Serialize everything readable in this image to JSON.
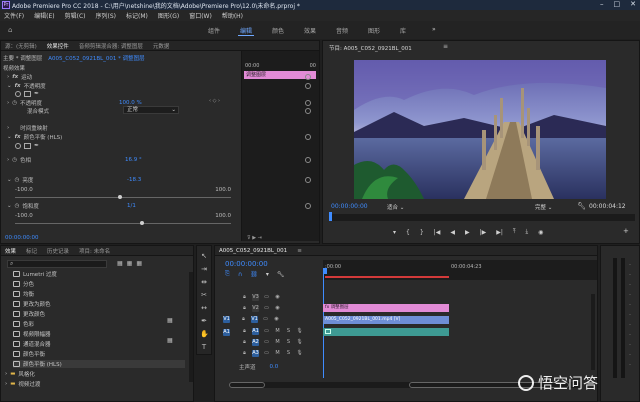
{
  "app": {
    "title": "Adobe Premiere Pro CC 2018 - C:\\用户\\netshine\\我的文档\\Adobe\\Premiere Pro\\12.0\\未命名.prproj *",
    "icon": "Pr"
  },
  "menu": [
    "文件(F)",
    "编辑(E)",
    "剪辑(C)",
    "序列(S)",
    "标记(M)",
    "图形(G)",
    "窗口(W)",
    "帮助(H)"
  ],
  "workspaces": {
    "items": [
      "组件",
      "编辑",
      "颜色",
      "效果",
      "音频",
      "图形",
      "库"
    ],
    "active": "编辑",
    "more": "»"
  },
  "effect_controls": {
    "tabs": [
      "源：(无剪辑)",
      "效果控件",
      "音频剪辑混合器: 调整图层",
      "元数据"
    ],
    "active_tab": "效果控件",
    "source_label": "主要 * 调整图层",
    "sequence_label": "A005_C052_0921BL_001 * 调整图层",
    "time_start": "00:00",
    "time_end": "00",
    "clip_bar_label": "调整图层",
    "section_video": "视频效果",
    "rows": {
      "motion": "运动",
      "opacity": "不透明度",
      "opacity_value": "100.0 %",
      "blend_label": "混合模式",
      "blend_value": "正常",
      "time_remap": "时间重映射",
      "lut_clip_sec": "颜色平衡 (HLS)",
      "hue_label": "色相",
      "hue_value": "16.9 °",
      "lightness_label": "亮度",
      "lightness_value": "-18.3",
      "lightness_min": "-100.0",
      "lightness_max": "100.0",
      "saturation_label": "饱和度",
      "saturation_value": "1/1",
      "saturation_min": "-100.0",
      "saturation_max": "100.0"
    },
    "timecode": "00:00:00:00"
  },
  "program_monitor": {
    "title": "节目: A005_C052_0921BL_001",
    "menu_icon": "≡",
    "timecode": "00:00:00:00",
    "fit": "适合",
    "quality": "完整",
    "duration": "00:00:04:12",
    "controls": [
      "▾",
      "{",
      "}",
      "|◀",
      "◀|",
      "◀",
      "▶",
      "|▶",
      "▶|",
      "⇥",
      "⇤",
      "⤒",
      "⤓",
      "◉"
    ]
  },
  "project_panel": {
    "tabs": [
      "效果",
      "标记",
      "历史记录",
      "项目: 未命名"
    ],
    "active_tab": "效果",
    "items": [
      "Lumetri 过度",
      "分色",
      "均衡",
      "更改为颜色",
      "更改颜色",
      "色彩",
      "视频限幅器",
      "通道混合器",
      "颜色平衡",
      "颜色平衡 (HLS)",
      "风格化",
      "",
      "",
      "过渡"
    ],
    "folders": [
      "风格化",
      "视频过渡"
    ]
  },
  "timeline": {
    "title": "A005_C052_0921BL_001",
    "menu_icon": "≡",
    "timecode": "00:00:00:00",
    "ruler": [
      ":00:00",
      "00:00:04:23"
    ],
    "tracks_video": [
      "V3",
      "V2",
      "V1"
    ],
    "tracks_audio": [
      "A1",
      "A2",
      "A3"
    ],
    "master": "主声道",
    "master_value": "0.0",
    "clip_adjustment": "调整图层",
    "clip_video": "A005_C052_0921BL_001.mp4 [V]",
    "v1_label": "V1",
    "a1_label": "A1"
  },
  "colors": {
    "accent": "#3f8cff",
    "adjustment_clip": "#e28bd6",
    "video_clip": "#6e8ed6",
    "audio_clip": "#3e9a93",
    "playhead": "#3f8cff",
    "work_area": "#d33a3a"
  },
  "watermark": "悟空问答"
}
